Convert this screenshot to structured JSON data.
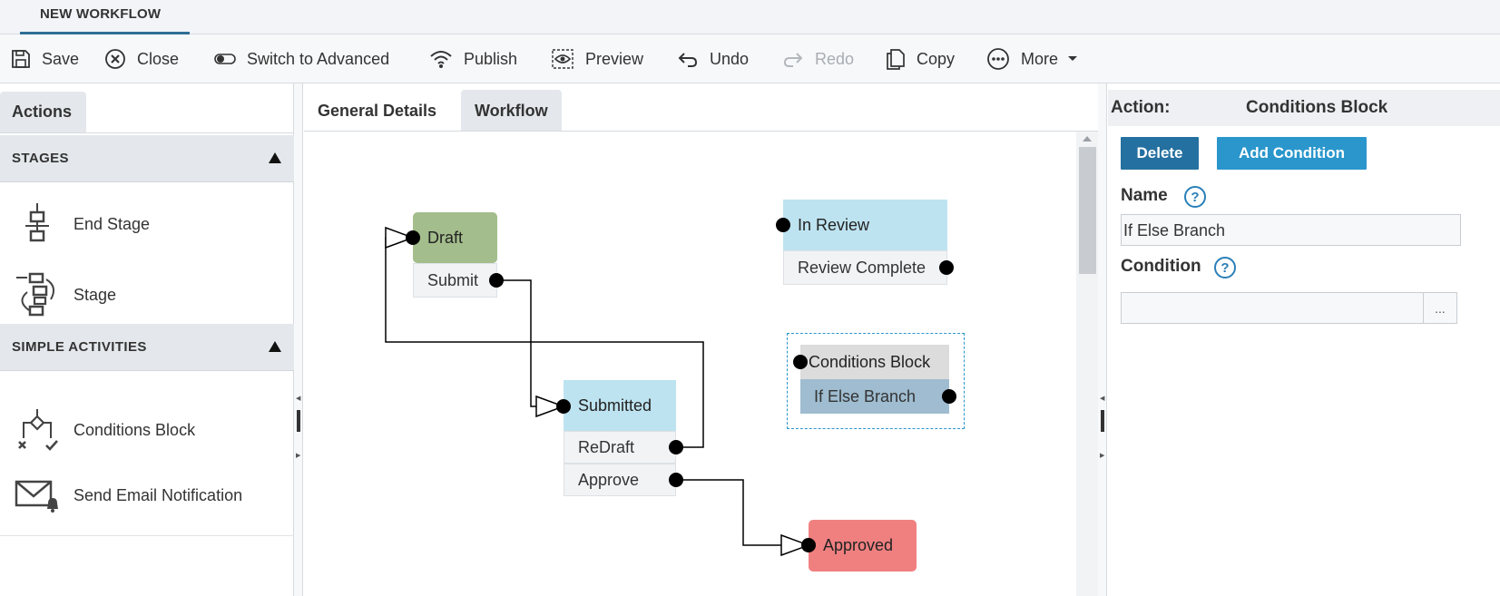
{
  "top_tab": {
    "label": "NEW WORKFLOW"
  },
  "toolbar": {
    "save": "Save",
    "close": "Close",
    "switch_advanced": "Switch to Advanced",
    "publish": "Publish",
    "preview": "Preview",
    "undo": "Undo",
    "redo": "Redo",
    "copy": "Copy",
    "more": "More"
  },
  "left_panel": {
    "tab": "Actions",
    "sections": [
      {
        "title": "STAGES",
        "items": [
          "End Stage",
          "Stage"
        ]
      },
      {
        "title": "SIMPLE ACTIVITIES",
        "items": [
          "Conditions Block",
          "Send Email Notification"
        ]
      }
    ]
  },
  "center": {
    "tabs": [
      {
        "label": "General Details",
        "active": false
      },
      {
        "label": "Workflow",
        "active": true
      }
    ],
    "nodes": {
      "draft": {
        "title": "Draft",
        "transitions": [
          "Submit"
        ],
        "color": "#a3bd8c"
      },
      "in_review": {
        "title": "In Review",
        "transitions": [
          "Review Complete"
        ],
        "color": "#bee3f0"
      },
      "conditions_block": {
        "title": "Conditions Block",
        "branches": [
          "If Else Branch"
        ],
        "color": "#dcdcdc"
      },
      "submitted": {
        "title": "Submitted",
        "transitions": [
          "ReDraft",
          "Approve"
        ],
        "color": "#bee3f0"
      },
      "approved": {
        "title": "Approved",
        "color": "#f08080"
      }
    }
  },
  "right_panel": {
    "action_label": "Action:",
    "action_value": "Conditions Block",
    "delete_button": "Delete",
    "add_condition_button": "Add Condition",
    "name_label": "Name",
    "name_value": "If Else Branch",
    "condition_label": "Condition",
    "condition_value": "",
    "ellipsis": "...",
    "help_glyph": "?"
  },
  "colors": {
    "accent_dark": "#2470a0",
    "accent": "#2a96cc",
    "selection": "#2a96cc"
  }
}
